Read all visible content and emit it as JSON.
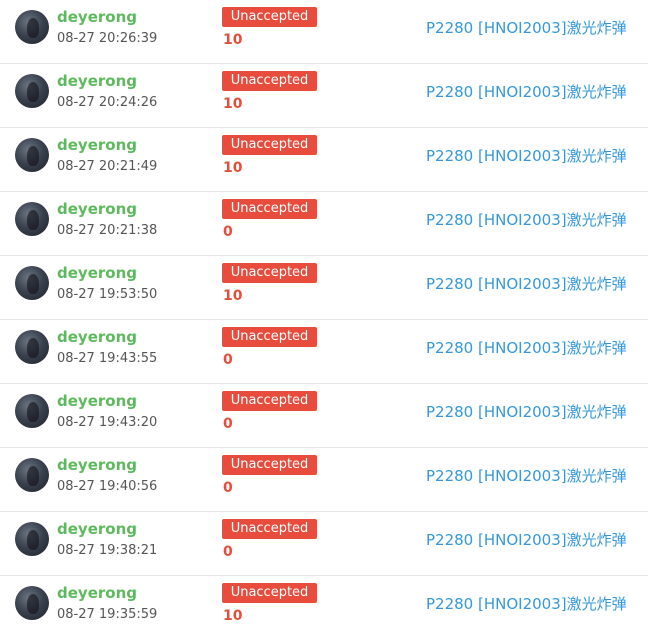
{
  "records": [
    {
      "username": "deyerong",
      "time": "08-27 20:26:39",
      "status": "Unaccepted",
      "score": "10",
      "problem": "P2280 [HNOI2003]激光炸弹"
    },
    {
      "username": "deyerong",
      "time": "08-27 20:24:26",
      "status": "Unaccepted",
      "score": "10",
      "problem": "P2280 [HNOI2003]激光炸弹"
    },
    {
      "username": "deyerong",
      "time": "08-27 20:21:49",
      "status": "Unaccepted",
      "score": "10",
      "problem": "P2280 [HNOI2003]激光炸弹"
    },
    {
      "username": "deyerong",
      "time": "08-27 20:21:38",
      "status": "Unaccepted",
      "score": "0",
      "problem": "P2280 [HNOI2003]激光炸弹"
    },
    {
      "username": "deyerong",
      "time": "08-27 19:53:50",
      "status": "Unaccepted",
      "score": "10",
      "problem": "P2280 [HNOI2003]激光炸弹"
    },
    {
      "username": "deyerong",
      "time": "08-27 19:43:55",
      "status": "Unaccepted",
      "score": "0",
      "problem": "P2280 [HNOI2003]激光炸弹"
    },
    {
      "username": "deyerong",
      "time": "08-27 19:43:20",
      "status": "Unaccepted",
      "score": "0",
      "problem": "P2280 [HNOI2003]激光炸弹"
    },
    {
      "username": "deyerong",
      "time": "08-27 19:40:56",
      "status": "Unaccepted",
      "score": "0",
      "problem": "P2280 [HNOI2003]激光炸弹"
    },
    {
      "username": "deyerong",
      "time": "08-27 19:38:21",
      "status": "Unaccepted",
      "score": "0",
      "problem": "P2280 [HNOI2003]激光炸弹"
    },
    {
      "username": "deyerong",
      "time": "08-27 19:35:59",
      "status": "Unaccepted",
      "score": "10",
      "problem": "P2280 [HNOI2003]激光炸弹"
    }
  ],
  "colors": {
    "username": "#5eb95e",
    "status_bg": "#e74c3c",
    "score": "#e74c3c",
    "link": "#3498db",
    "divider": "#e6e6e6"
  }
}
